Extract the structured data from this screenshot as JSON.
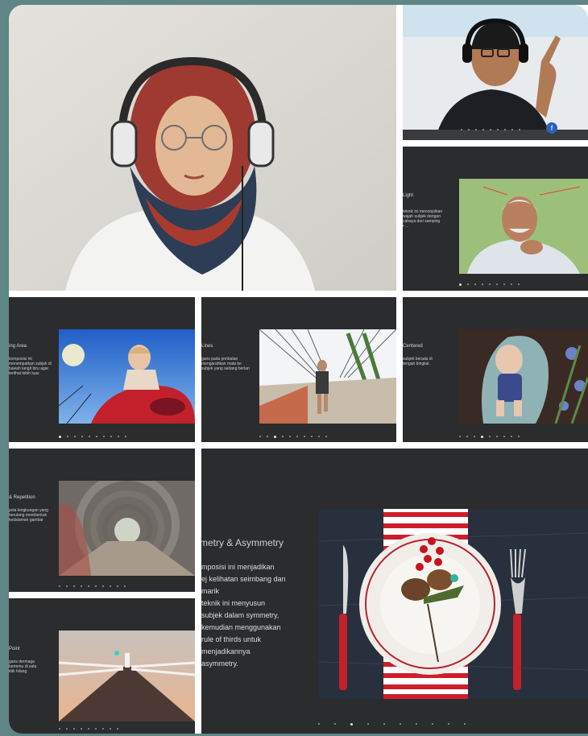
{
  "camera_presenter_woman": {
    "alt": "presenter-camera-woman"
  },
  "camera_presenter_man": {
    "alt": "presenter-camera-man",
    "badge_icon": "facebook-icon"
  },
  "slides": [
    {
      "id": "portrait",
      "title": "Light",
      "body": "teknik ini menonjolkan\nwajah subjek dengan\ncahaya dari samping\n• ...",
      "photo": "elderly-man-portrait"
    },
    {
      "id": "low-angle",
      "title": "ing Area",
      "body": "komposisi ini\nmenempatkan subjek di\nbawah langit biru agar\nterlihat lebih luas\n",
      "photo": "child-on-playground"
    },
    {
      "id": "leading-lines",
      "title": "Lines",
      "body": "garis pada jembatan\nmengarahkan mata ke\nsubjek yang sedang berlari\n",
      "photo": "runner-on-bridge"
    },
    {
      "id": "framing",
      "title": "Centered",
      "body": "subjek berada di\ntengah bingkai\n",
      "photo": "baby-in-car-seat"
    },
    {
      "id": "repetition",
      "title": "& Repetition",
      "body": "pola lengkungan yang\nberulang membentuk\nkedalaman gambar\n",
      "photo": "arch-tunnel"
    },
    {
      "id": "vanishing",
      "title": "Point",
      "body": "garis dermaga\nbertemu di satu\ntitik hilang\n",
      "photo": "pier-lighthouse"
    }
  ],
  "main_slide": {
    "title": "metry & Asymmetry",
    "body": "mposisi ini menjadikan\nej kelihatan seimbang dan\nmarik\n teknik ini menyusun\n subjek dalam symmetry,\n kemudian menggunakan\n rule of thirds untuk\n menjadikannya\n asymmetry.",
    "photo": "christmas-table-setting"
  },
  "colors": {
    "app_background": "#5f8584",
    "slide_background": "#2b2c2e",
    "grid_gap": "#ffffff"
  }
}
